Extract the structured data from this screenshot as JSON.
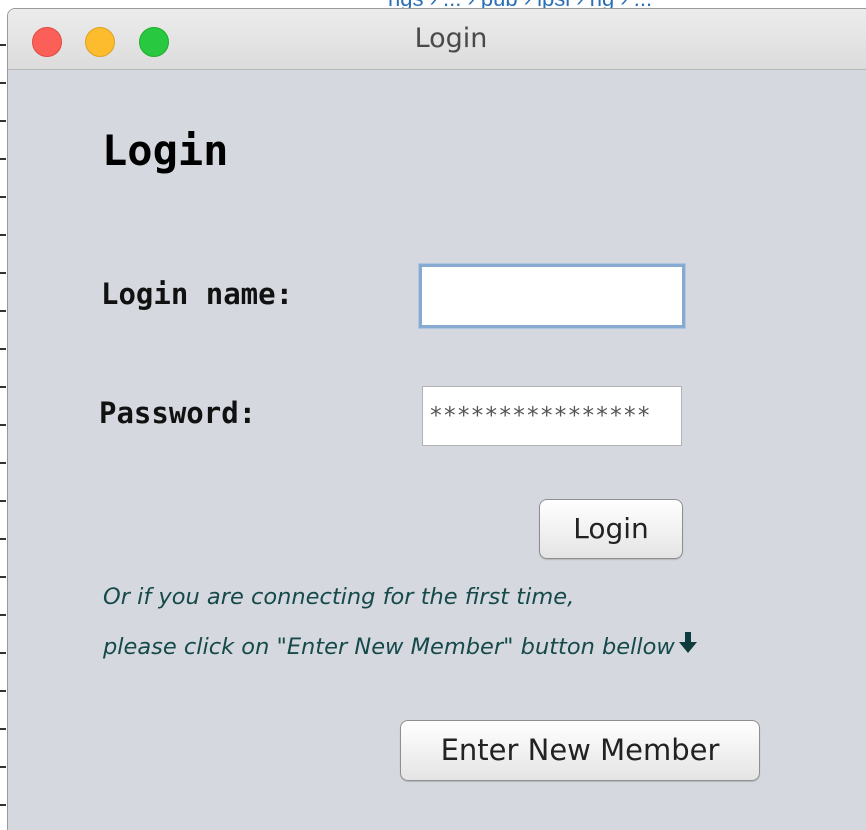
{
  "background": {
    "partial_link_text": "ngs › ... › pub › lpsi › ng › ..."
  },
  "window": {
    "title": "Login"
  },
  "form": {
    "heading": "Login",
    "login_name_label": "Login name:",
    "login_name_value": "",
    "password_label": "Password:",
    "password_value": "****************",
    "login_button": "Login",
    "hint_line1": "Or if you are connecting for the first time,",
    "hint_line2": "please click on \"Enter New Member\" button bellow",
    "arrow_icon": "arrow-down-icon",
    "new_member_button": "Enter New Member"
  },
  "colors": {
    "window_bg": "#d6d8df",
    "hint_text": "#164a4a",
    "focus_ring": "#88a9d0",
    "close": "#fc5f57",
    "minimize": "#fdbc2e",
    "zoom": "#28c840"
  }
}
